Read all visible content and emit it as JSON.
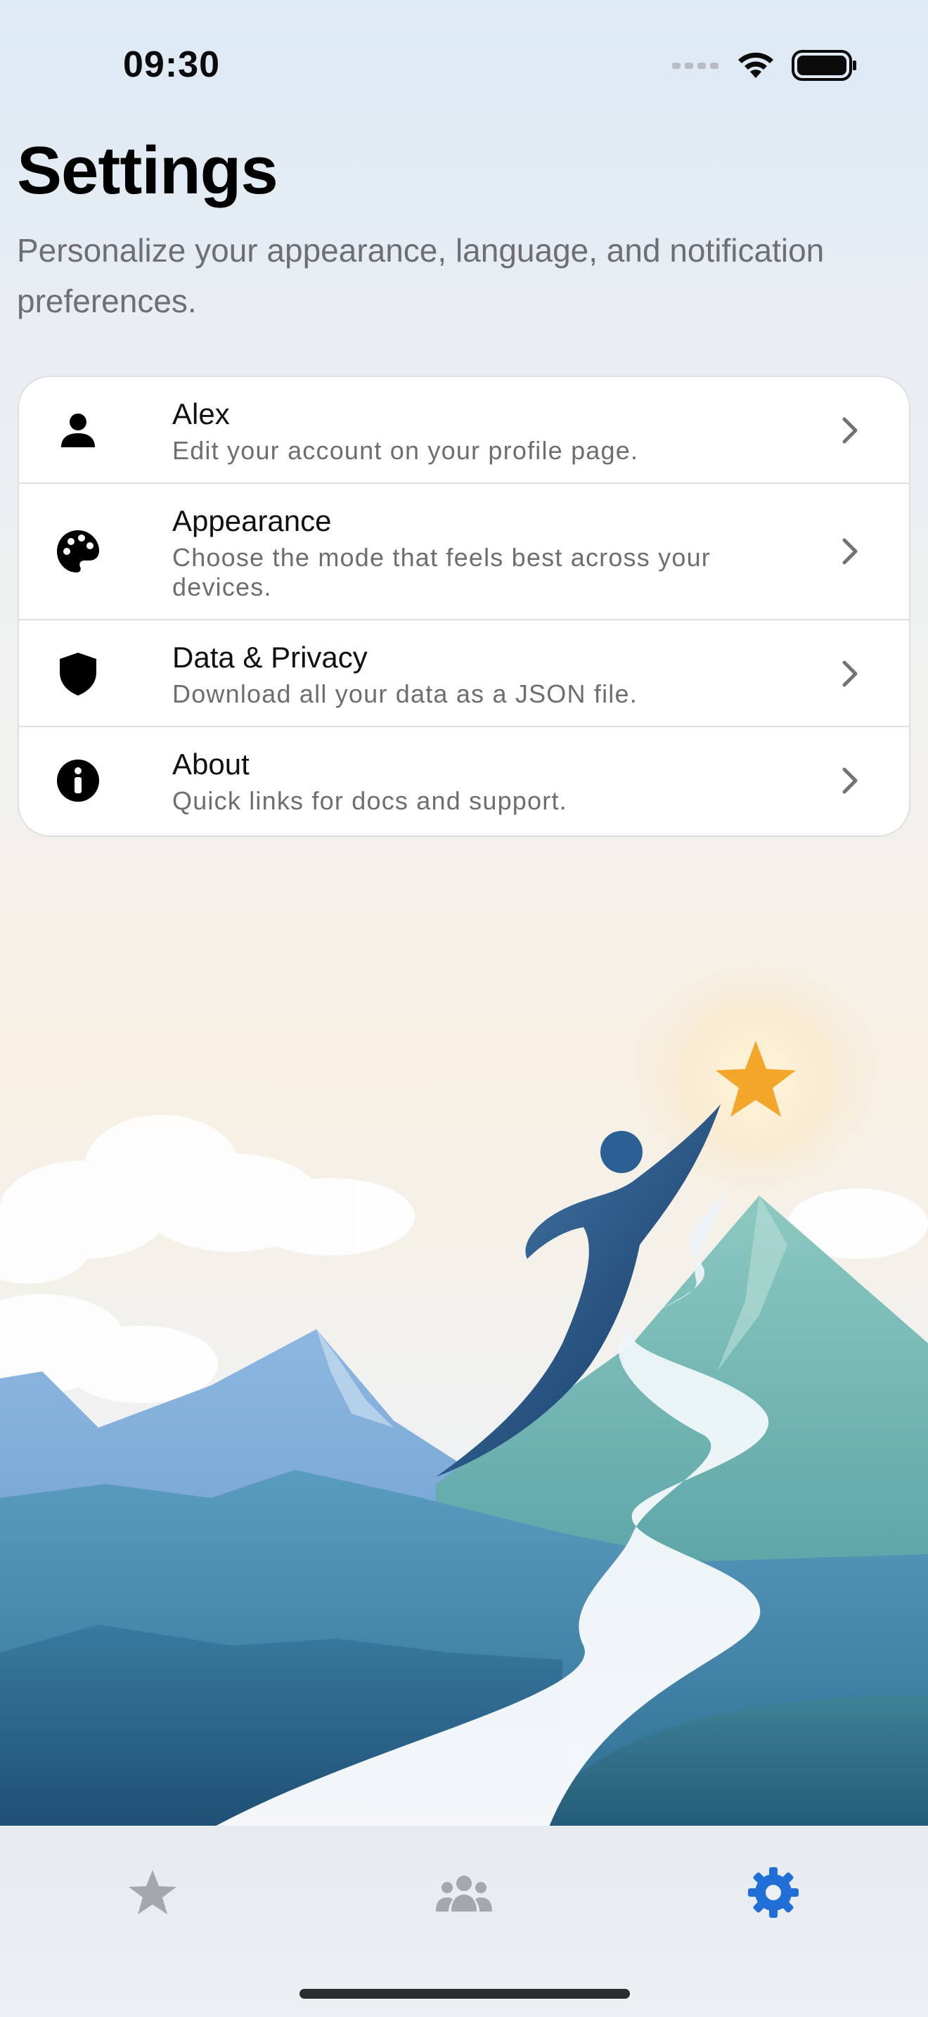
{
  "status_bar": {
    "time": "09:30",
    "icons": [
      "cellular-signal-icon",
      "wifi-icon",
      "battery-icon"
    ]
  },
  "header": {
    "title": "Settings",
    "subtitle": "Personalize your appearance, language, and notification preferences."
  },
  "settings": {
    "items": [
      {
        "title": "Alex",
        "description": "Edit your account on your profile page.",
        "icon": "person-icon"
      },
      {
        "title": "Appearance",
        "description": "Choose the mode that feels best across your devices.",
        "icon": "palette-icon"
      },
      {
        "title": "Data & Privacy",
        "description": "Download all your data as a JSON file.",
        "icon": "shield-icon"
      },
      {
        "title": "About",
        "description": "Quick links for docs and support.",
        "icon": "info-icon"
      }
    ]
  },
  "tab_bar": {
    "tabs": [
      {
        "name": "favorites",
        "icon": "star-icon",
        "active": false
      },
      {
        "name": "community",
        "icon": "people-icon",
        "active": false
      },
      {
        "name": "settings",
        "icon": "gear-icon",
        "active": true
      }
    ],
    "active_color": "#1f6fd6",
    "inactive_color": "#a4a7ad"
  },
  "colors": {
    "accent": "#1f6fd6",
    "star": "#f4a62a"
  }
}
